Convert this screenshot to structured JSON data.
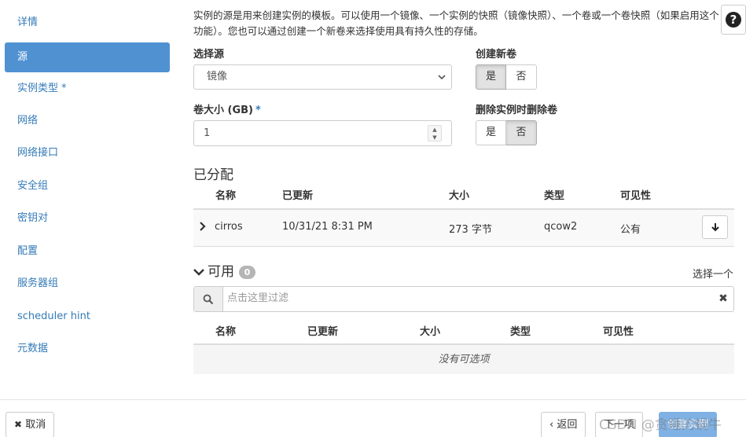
{
  "sidebar": {
    "items": [
      {
        "label": "详情",
        "active": false,
        "required": false
      },
      {
        "label": "源",
        "active": true,
        "required": false
      },
      {
        "label": "实例类型",
        "active": false,
        "required": true
      },
      {
        "label": "网络",
        "active": false,
        "required": false
      },
      {
        "label": "网络接口",
        "active": false,
        "required": false
      },
      {
        "label": "安全组",
        "active": false,
        "required": false
      },
      {
        "label": "密钥对",
        "active": false,
        "required": false
      },
      {
        "label": "配置",
        "active": false,
        "required": false
      },
      {
        "label": "服务器组",
        "active": false,
        "required": false
      },
      {
        "label": "scheduler hint",
        "active": false,
        "required": false
      },
      {
        "label": "元数据",
        "active": false,
        "required": false
      }
    ],
    "required_mark": "*"
  },
  "description": "实例的源是用来创建实例的模板。可以使用一个镜像、一个实例的快照（镜像快照）、一个卷或一个卷快照（如果启用这个功能）。您也可以通过创建一个新卷来选择使用具有持久性的存储。",
  "help_icon": "question-circle-icon",
  "form": {
    "select_source_label": "选择源",
    "select_source_value": "镜像",
    "volume_size_label": "卷大小 (GB)",
    "volume_size_required": "*",
    "volume_size_value": "1",
    "create_volume_label": "创建新卷",
    "create_volume_yes": "是",
    "create_volume_no": "否",
    "create_volume_selected": "是",
    "delete_volume_label": "删除实例时删除卷",
    "delete_volume_yes": "是",
    "delete_volume_no": "否",
    "delete_volume_selected": "否"
  },
  "allocated": {
    "title": "已分配",
    "columns": [
      "名称",
      "已更新",
      "大小",
      "类型",
      "可见性"
    ],
    "rows": [
      {
        "name": "cirros",
        "updated": "10/31/21 8:31 PM",
        "size": "273 字节",
        "type": "qcow2",
        "visibility": "公有"
      }
    ]
  },
  "available": {
    "title": "可用",
    "count": "0",
    "select_one": "选择一个",
    "filter_placeholder": "点击这里过滤",
    "columns": [
      "名称",
      "已更新",
      "大小",
      "类型",
      "可见性"
    ],
    "empty_text": "没有可选项"
  },
  "footer": {
    "cancel_label": "取消",
    "back_label": "‹ 返回",
    "next_label": "下一项",
    "launch_label": "创建实例"
  },
  "watermark": "CSDN @贪睡的蜗牛",
  "colors": {
    "accent": "#5091d2",
    "link": "#337ab7",
    "primary_button": "#7fb1e4"
  }
}
